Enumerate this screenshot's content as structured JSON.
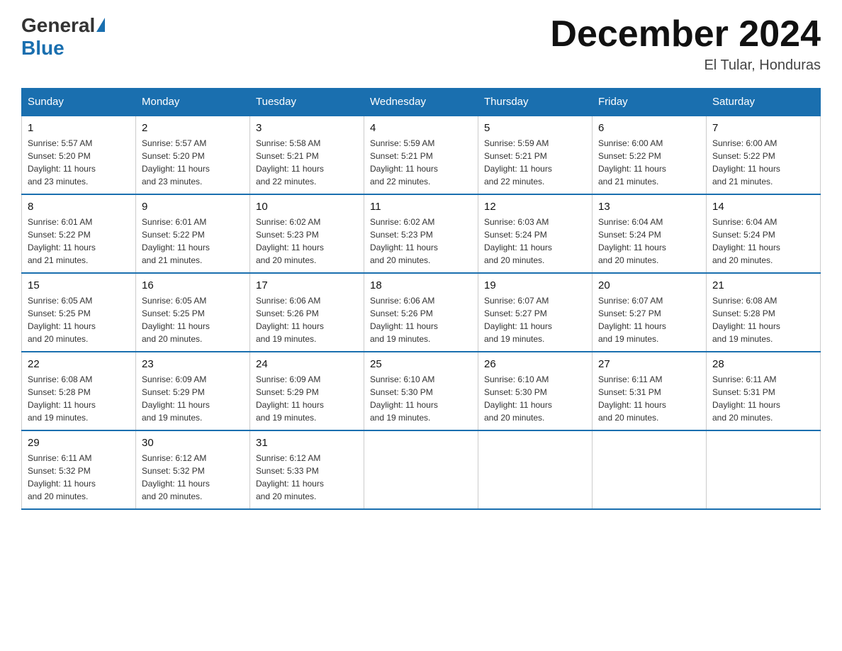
{
  "header": {
    "logo_general": "General",
    "logo_blue": "Blue",
    "month_title": "December 2024",
    "location": "El Tular, Honduras"
  },
  "weekdays": [
    "Sunday",
    "Monday",
    "Tuesday",
    "Wednesday",
    "Thursday",
    "Friday",
    "Saturday"
  ],
  "weeks": [
    [
      {
        "day": "1",
        "sunrise": "5:57 AM",
        "sunset": "5:20 PM",
        "daylight": "11 hours and 23 minutes."
      },
      {
        "day": "2",
        "sunrise": "5:57 AM",
        "sunset": "5:20 PM",
        "daylight": "11 hours and 23 minutes."
      },
      {
        "day": "3",
        "sunrise": "5:58 AM",
        "sunset": "5:21 PM",
        "daylight": "11 hours and 22 minutes."
      },
      {
        "day": "4",
        "sunrise": "5:59 AM",
        "sunset": "5:21 PM",
        "daylight": "11 hours and 22 minutes."
      },
      {
        "day": "5",
        "sunrise": "5:59 AM",
        "sunset": "5:21 PM",
        "daylight": "11 hours and 22 minutes."
      },
      {
        "day": "6",
        "sunrise": "6:00 AM",
        "sunset": "5:22 PM",
        "daylight": "11 hours and 21 minutes."
      },
      {
        "day": "7",
        "sunrise": "6:00 AM",
        "sunset": "5:22 PM",
        "daylight": "11 hours and 21 minutes."
      }
    ],
    [
      {
        "day": "8",
        "sunrise": "6:01 AM",
        "sunset": "5:22 PM",
        "daylight": "11 hours and 21 minutes."
      },
      {
        "day": "9",
        "sunrise": "6:01 AM",
        "sunset": "5:22 PM",
        "daylight": "11 hours and 21 minutes."
      },
      {
        "day": "10",
        "sunrise": "6:02 AM",
        "sunset": "5:23 PM",
        "daylight": "11 hours and 20 minutes."
      },
      {
        "day": "11",
        "sunrise": "6:02 AM",
        "sunset": "5:23 PM",
        "daylight": "11 hours and 20 minutes."
      },
      {
        "day": "12",
        "sunrise": "6:03 AM",
        "sunset": "5:24 PM",
        "daylight": "11 hours and 20 minutes."
      },
      {
        "day": "13",
        "sunrise": "6:04 AM",
        "sunset": "5:24 PM",
        "daylight": "11 hours and 20 minutes."
      },
      {
        "day": "14",
        "sunrise": "6:04 AM",
        "sunset": "5:24 PM",
        "daylight": "11 hours and 20 minutes."
      }
    ],
    [
      {
        "day": "15",
        "sunrise": "6:05 AM",
        "sunset": "5:25 PM",
        "daylight": "11 hours and 20 minutes."
      },
      {
        "day": "16",
        "sunrise": "6:05 AM",
        "sunset": "5:25 PM",
        "daylight": "11 hours and 20 minutes."
      },
      {
        "day": "17",
        "sunrise": "6:06 AM",
        "sunset": "5:26 PM",
        "daylight": "11 hours and 19 minutes."
      },
      {
        "day": "18",
        "sunrise": "6:06 AM",
        "sunset": "5:26 PM",
        "daylight": "11 hours and 19 minutes."
      },
      {
        "day": "19",
        "sunrise": "6:07 AM",
        "sunset": "5:27 PM",
        "daylight": "11 hours and 19 minutes."
      },
      {
        "day": "20",
        "sunrise": "6:07 AM",
        "sunset": "5:27 PM",
        "daylight": "11 hours and 19 minutes."
      },
      {
        "day": "21",
        "sunrise": "6:08 AM",
        "sunset": "5:28 PM",
        "daylight": "11 hours and 19 minutes."
      }
    ],
    [
      {
        "day": "22",
        "sunrise": "6:08 AM",
        "sunset": "5:28 PM",
        "daylight": "11 hours and 19 minutes."
      },
      {
        "day": "23",
        "sunrise": "6:09 AM",
        "sunset": "5:29 PM",
        "daylight": "11 hours and 19 minutes."
      },
      {
        "day": "24",
        "sunrise": "6:09 AM",
        "sunset": "5:29 PM",
        "daylight": "11 hours and 19 minutes."
      },
      {
        "day": "25",
        "sunrise": "6:10 AM",
        "sunset": "5:30 PM",
        "daylight": "11 hours and 19 minutes."
      },
      {
        "day": "26",
        "sunrise": "6:10 AM",
        "sunset": "5:30 PM",
        "daylight": "11 hours and 20 minutes."
      },
      {
        "day": "27",
        "sunrise": "6:11 AM",
        "sunset": "5:31 PM",
        "daylight": "11 hours and 20 minutes."
      },
      {
        "day": "28",
        "sunrise": "6:11 AM",
        "sunset": "5:31 PM",
        "daylight": "11 hours and 20 minutes."
      }
    ],
    [
      {
        "day": "29",
        "sunrise": "6:11 AM",
        "sunset": "5:32 PM",
        "daylight": "11 hours and 20 minutes."
      },
      {
        "day": "30",
        "sunrise": "6:12 AM",
        "sunset": "5:32 PM",
        "daylight": "11 hours and 20 minutes."
      },
      {
        "day": "31",
        "sunrise": "6:12 AM",
        "sunset": "5:33 PM",
        "daylight": "11 hours and 20 minutes."
      },
      null,
      null,
      null,
      null
    ]
  ],
  "labels": {
    "sunrise": "Sunrise:",
    "sunset": "Sunset:",
    "daylight": "Daylight:"
  }
}
